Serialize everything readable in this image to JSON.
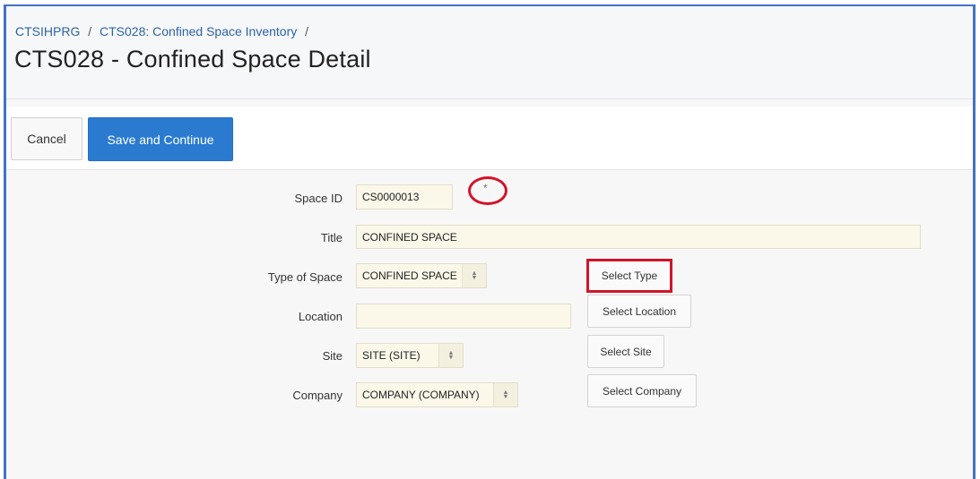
{
  "breadcrumb": {
    "items": [
      {
        "label": "CTSIHPRG"
      },
      {
        "label": "CTS028: Confined Space Inventory"
      }
    ],
    "separator": "/"
  },
  "page": {
    "title": "CTS028 - Confined Space Detail"
  },
  "toolbar": {
    "cancel_label": "Cancel",
    "save_label": "Save and Continue"
  },
  "form": {
    "space_id": {
      "label": "Space ID",
      "value": "CS0000013",
      "required_marker": "*"
    },
    "title": {
      "label": "Title",
      "value": "CONFINED SPACE"
    },
    "type_of_space": {
      "label": "Type of Space",
      "selected": "CONFINED SPACE",
      "button": "Select Type"
    },
    "location": {
      "label": "Location",
      "value": "",
      "button": "Select Location"
    },
    "site": {
      "label": "Site",
      "selected": "SITE (SITE)",
      "button": "Select Site"
    },
    "company": {
      "label": "Company",
      "selected": "COMPANY (COMPANY)",
      "button": "Select Company"
    }
  },
  "colors": {
    "accent": "#2a7bd0",
    "annotation_red": "#d0142a",
    "field_background": "#fbf8e9",
    "frame_border": "#4472c4"
  },
  "icons": {
    "select_arrow": "up-down-caret-icon"
  }
}
